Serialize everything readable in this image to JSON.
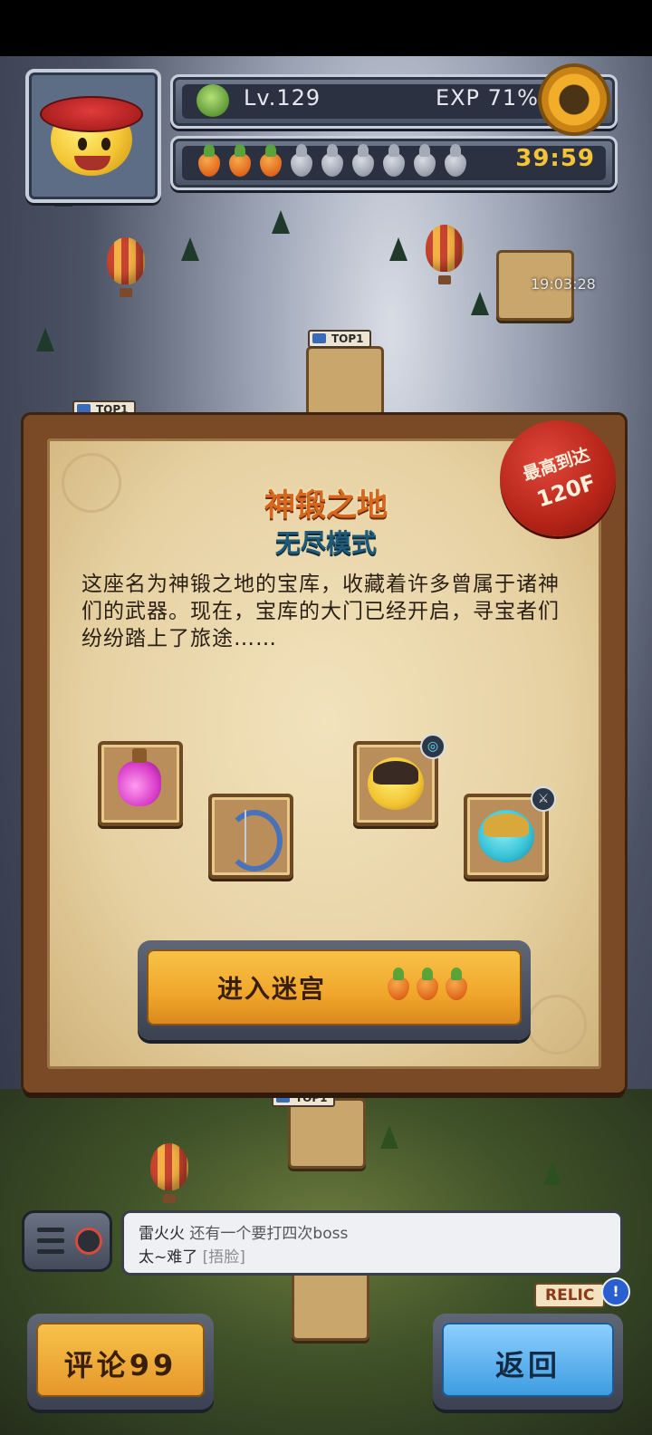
{
  "hud": {
    "level_label": "Lv.129",
    "exp_label": "EXP 71%",
    "exp_percent": 71,
    "energy_full": 3,
    "energy_total": 9,
    "energy_timer": "39:59"
  },
  "map": {
    "chest_timer": "19:03:28",
    "top_tags": [
      "TOP1",
      "TOP1",
      "TOP1"
    ],
    "relic_label": "RELIC",
    "alert_symbol": "!"
  },
  "dialog": {
    "seal_line1": "最高到达",
    "seal_line2": "120F",
    "title": "神锻之地",
    "subtitle": "无尽模式",
    "description": "这座名为神锻之地的宝库，收藏着许多曾属于诸神们的武器。现在，宝库的大门已经开启，寻宝者们纷纷踏上了旅途……",
    "rewards": [
      {
        "icon": "potion-icon"
      },
      {
        "icon": "bow-icon"
      },
      {
        "icon": "hero-samurai-icon"
      },
      {
        "icon": "hero-knight-icon"
      }
    ],
    "enter_label": "进入迷宫",
    "enter_cost": 3
  },
  "chat": {
    "name": "雷火火",
    "message_line1": "还有一个要打四次boss",
    "message_line2": "太~难了",
    "emote": "[捂脸]"
  },
  "buttons": {
    "comment_label": "评论99",
    "back_label": "返回"
  },
  "colors": {
    "title": "#d7671d",
    "subtitle": "#1f5a78",
    "timer": "#f4c438",
    "seal": "#b52418"
  }
}
